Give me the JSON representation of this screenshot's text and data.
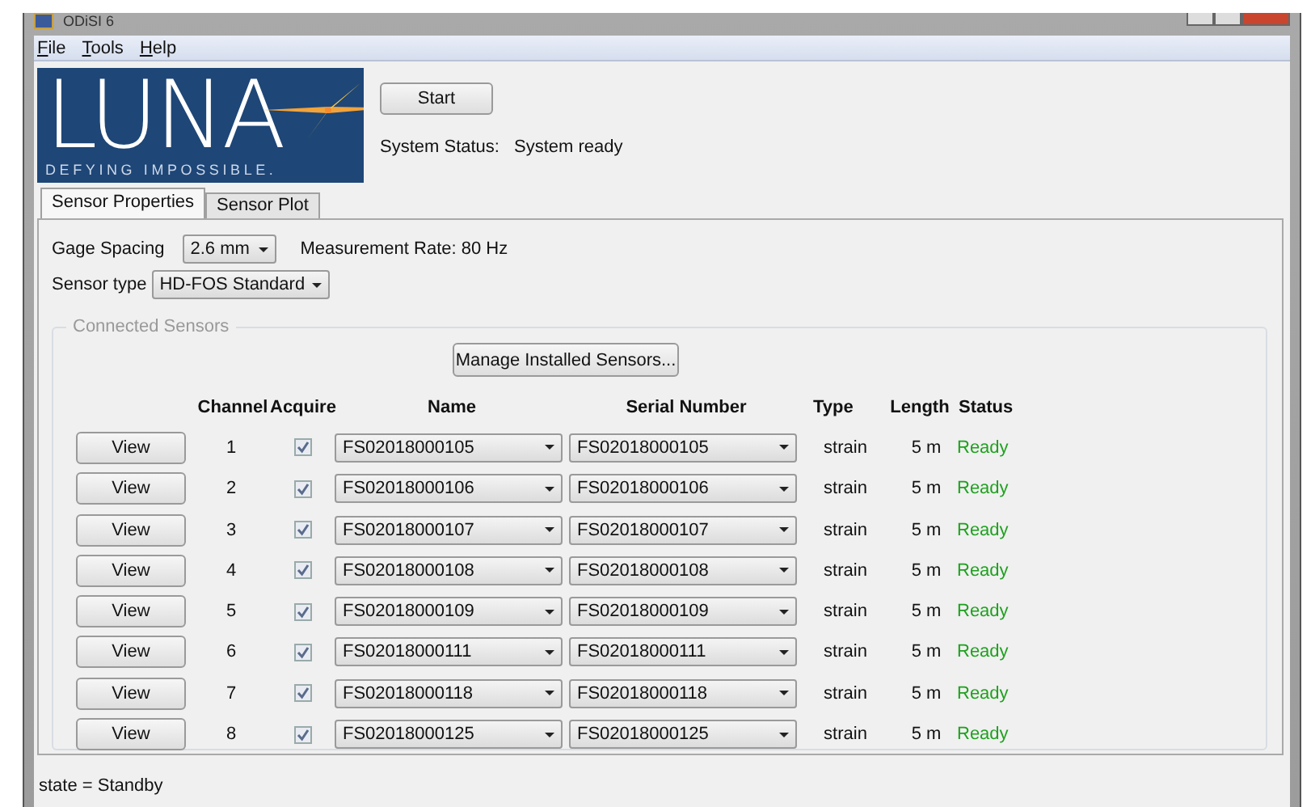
{
  "window": {
    "title": "ODiSI 6"
  },
  "menu": [
    {
      "label": "File"
    },
    {
      "label": "Tools"
    },
    {
      "label": "Help"
    }
  ],
  "logo": {
    "wordmark": "LUNA",
    "tagline": "DEFYING IMPOSSIBLE."
  },
  "start_button": "Start",
  "system_status": {
    "label": "System Status:",
    "value": "System ready"
  },
  "tabs": [
    {
      "label": "Sensor Properties",
      "selected": true
    },
    {
      "label": "Sensor Plot",
      "selected": false
    }
  ],
  "gage_spacing": {
    "label": "Gage Spacing",
    "value": "2.6 mm"
  },
  "measurement_rate": "Measurement Rate: 80 Hz",
  "sensor_type": {
    "label": "Sensor type",
    "value": "HD-FOS Standard"
  },
  "connected_sensors": {
    "title": "Connected Sensors",
    "manage_button": "Manage Installed Sensors...",
    "columns": [
      "Channel",
      "Acquire",
      "Name",
      "Serial Number",
      "Type",
      "Length",
      "Status"
    ],
    "rows": [
      {
        "button": "View",
        "channel": "1",
        "acquire": true,
        "name": "FS02018000105",
        "serial": "FS02018000105",
        "type": "strain",
        "length": "5 m",
        "status": "Ready"
      },
      {
        "button": "View",
        "channel": "2",
        "acquire": true,
        "name": "FS02018000106",
        "serial": "FS02018000106",
        "type": "strain",
        "length": "5 m",
        "status": "Ready"
      },
      {
        "button": "View",
        "channel": "3",
        "acquire": true,
        "name": "FS02018000107",
        "serial": "FS02018000107",
        "type": "strain",
        "length": "5 m",
        "status": "Ready"
      },
      {
        "button": "View",
        "channel": "4",
        "acquire": true,
        "name": "FS02018000108",
        "serial": "FS02018000108",
        "type": "strain",
        "length": "5 m",
        "status": "Ready"
      },
      {
        "button": "View",
        "channel": "5",
        "acquire": true,
        "name": "FS02018000109",
        "serial": "FS02018000109",
        "type": "strain",
        "length": "5 m",
        "status": "Ready"
      },
      {
        "button": "View",
        "channel": "6",
        "acquire": true,
        "name": "FS02018000111",
        "serial": "FS02018000111",
        "type": "strain",
        "length": "5 m",
        "status": "Ready"
      },
      {
        "button": "View",
        "channel": "7",
        "acquire": true,
        "name": "FS02018000118",
        "serial": "FS02018000118",
        "type": "strain",
        "length": "5 m",
        "status": "Ready"
      },
      {
        "button": "View",
        "channel": "8",
        "acquire": true,
        "name": "FS02018000125",
        "serial": "FS02018000125",
        "type": "strain",
        "length": "5 m",
        "status": "Ready"
      }
    ]
  },
  "status_bar": "state = Standby"
}
